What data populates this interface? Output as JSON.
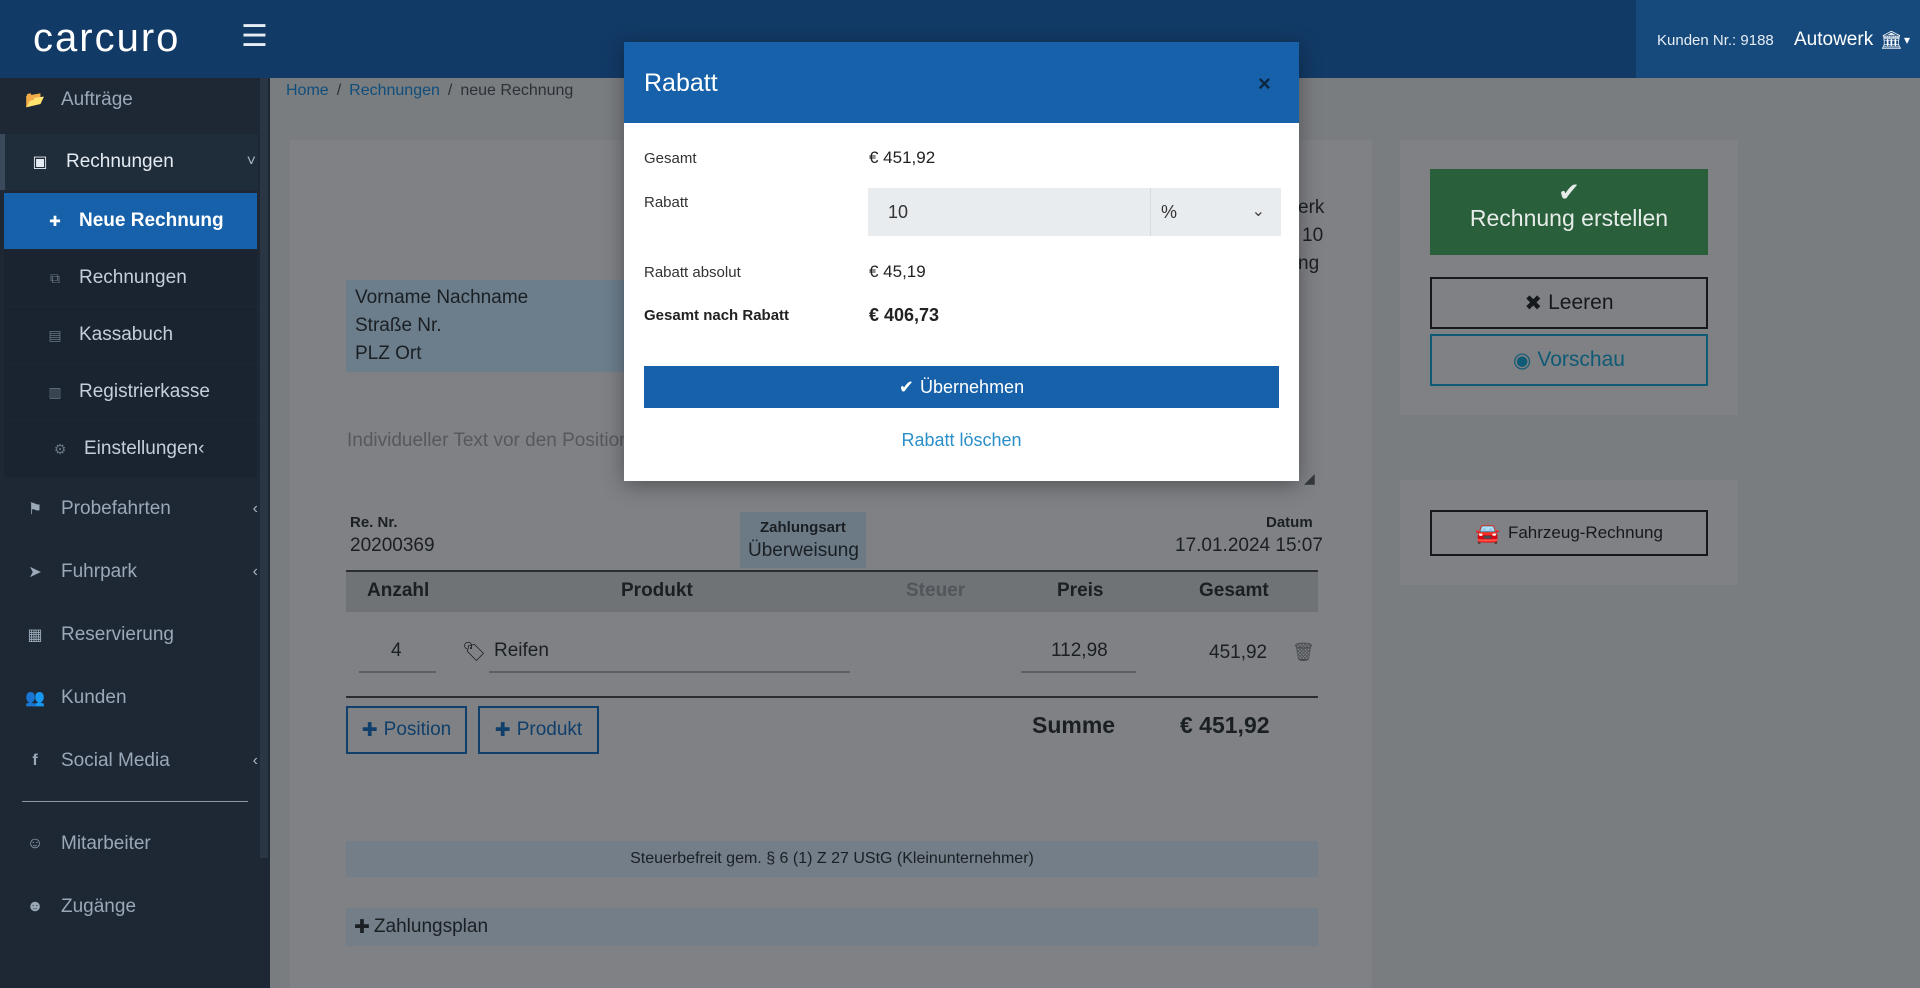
{
  "topbar": {
    "logo": "carcuro",
    "hamburger_glyph": "☰",
    "kunden_nr": "Kunden Nr.: 9188",
    "account": "Autowerk",
    "account_icon": "bank-icon",
    "caret": "▾"
  },
  "sidebar": {
    "items": [
      {
        "label": "Aufträge",
        "icon": "folder-open-icon",
        "glyph": "📂"
      },
      {
        "label": "Rechnungen",
        "icon": "money-icon",
        "glyph": "▣"
      },
      {
        "label": "Probefahrten",
        "icon": "flag-icon",
        "glyph": "⚑"
      },
      {
        "label": "Fuhrpark",
        "icon": "location-arrow-icon",
        "glyph": "➤"
      },
      {
        "label": "Reservierung",
        "icon": "calendar-icon",
        "glyph": "▦"
      },
      {
        "label": "Kunden",
        "icon": "users-icon",
        "glyph": "👥"
      },
      {
        "label": "Social Media",
        "icon": "facebook-icon",
        "glyph": "f"
      },
      {
        "label": "Mitarbeiter",
        "icon": "user-icon",
        "glyph": "☺"
      },
      {
        "label": "Zugänge",
        "icon": "user-circle-icon",
        "glyph": "☻"
      }
    ],
    "submenu": [
      {
        "label": "Neue Rechnung",
        "icon": "plus-icon",
        "glyph": "✚"
      },
      {
        "label": "Rechnungen",
        "icon": "copy-icon",
        "glyph": "⧉"
      },
      {
        "label": "Kassabuch",
        "icon": "book-icon",
        "glyph": "▤"
      },
      {
        "label": "Registrierkasse",
        "icon": "register-icon",
        "glyph": "▥"
      },
      {
        "label": "Einstellungen",
        "icon": "cog-icon",
        "glyph": "⚙"
      }
    ],
    "chevron_down": "˅",
    "chevron_left": "‹"
  },
  "breadcrumb": {
    "home": "Home",
    "rechnungen": "Rechnungen",
    "current": "neue Rechnung",
    "separator": "/"
  },
  "invoice": {
    "address": [
      "Vorname Nachname",
      "Straße Nr.",
      "PLZ Ort"
    ],
    "company_fragments": [
      "erk",
      "10",
      "ng"
    ],
    "text_placeholder": "Individueller Text vor den Position",
    "re_nr_label": "Re. Nr.",
    "re_nr": "20200369",
    "zahlungsart_label": "Zahlungsart",
    "zahlungsart": "Überweisung",
    "datum_label": "Datum",
    "datum": "17.01.2024 15:07",
    "table": {
      "headers": [
        "Anzahl",
        "Produkt",
        "Steuer",
        "Preis",
        "Gesamt"
      ],
      "rows": [
        {
          "anzahl": "4",
          "produkt": "Reifen",
          "preis": "112,98",
          "gesamt": "451,92"
        }
      ]
    },
    "btn_position": "Position",
    "btn_produkt": "Produkt",
    "summe_label": "Summe",
    "summe": "€ 451,92",
    "steuer_text": "Steuerbefreit gem. § 6 (1) Z 27 UStG (Kleinunternehmer)",
    "zahlungsplan": "Zahlungsplan"
  },
  "actions": {
    "erstellen": "Rechnung erstellen",
    "leeren": "Leeren",
    "vorschau": "Vorschau",
    "fahrzeug": "Fahrzeug-Rechnung"
  },
  "modal": {
    "title": "Rabatt",
    "close": "×",
    "gesamt_label": "Gesamt",
    "gesamt_value": "€ 451,92",
    "rabatt_label": "Rabatt",
    "rabatt_value": "10",
    "rabatt_unit": "%",
    "rabatt_absolut_label": "Rabatt absolut",
    "rabatt_absolut_value": "€ 45,19",
    "gesamt_nach_label": "Gesamt nach Rabatt",
    "gesamt_nach_value": "€ 406,73",
    "uebernehmen": "Übernehmen",
    "loeschen": "Rabatt löschen"
  },
  "colors": {
    "topbar": "#123a66",
    "primary": "#1661a9",
    "success": "#2a5f3c",
    "link": "#2a8fc9"
  }
}
